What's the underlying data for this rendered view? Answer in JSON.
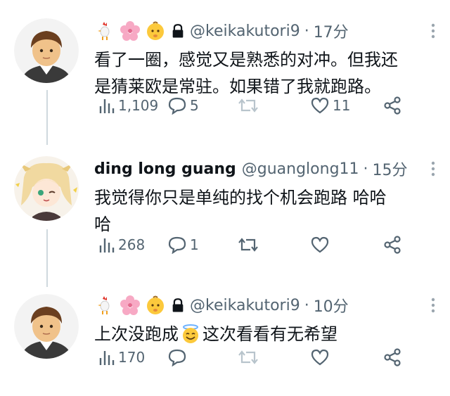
{
  "tweets": [
    {
      "display_name": "",
      "handle": "@keikakutori9",
      "separator": "·",
      "time": "17分",
      "text_lines": [
        "看了一圈，感觉又是熟悉的对冲。但我还",
        "是猜莱欧是常驻。如果错了我就跑路。"
      ],
      "stats": {
        "views": "1,109",
        "replies": "5",
        "retweets": "",
        "likes": "11"
      },
      "header_icons": [
        "rooster-icon",
        "cherry-blossom-icon",
        "baby-icon",
        "lock-icon"
      ]
    },
    {
      "display_name": "ding long guang",
      "handle": "@guanglong11",
      "separator": "·",
      "time": "15分",
      "text_lines": [
        "我觉得你只是单纯的找个机会跑路 哈哈",
        "哈"
      ],
      "stats": {
        "views": "268",
        "replies": "1",
        "retweets": "",
        "likes": ""
      }
    },
    {
      "display_name": "",
      "handle": "@keikakutori9",
      "separator": "·",
      "time": "10分",
      "text_before_emoji": "上次没跑成",
      "text_after_emoji": "这次看看有无希望",
      "stats": {
        "views": "170",
        "replies": "",
        "retweets": "",
        "likes": ""
      },
      "header_icons": [
        "rooster-icon",
        "cherry-blossom-icon",
        "baby-icon",
        "lock-icon"
      ]
    }
  ],
  "colors": {
    "text": "#0f1419",
    "muted": "#536471",
    "thread_line": "#cfd9de"
  }
}
